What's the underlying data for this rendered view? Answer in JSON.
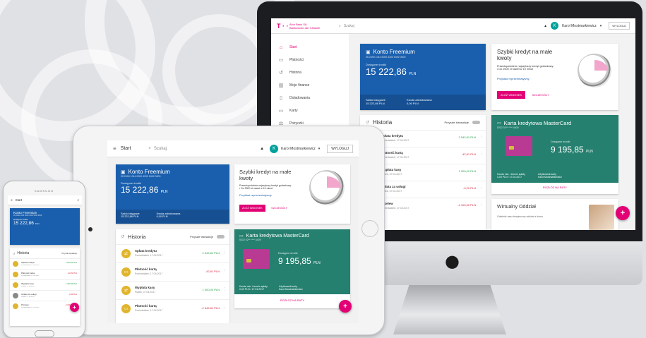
{
  "brand": {
    "logo": "T · ·",
    "name_line1": "Alior Bank SA",
    "name_line2": "Bankowość dla T-Mobile"
  },
  "search": {
    "placeholder": "Szukaj",
    "icon": "search-icon"
  },
  "user": {
    "initial": "K",
    "name": "Karol Mostmarkiewicz",
    "name_ipad": "Karol Mostmarkiewicz"
  },
  "logout_label": "WYLOGUJ",
  "page_title": "Start",
  "sidebar": {
    "items": [
      {
        "label": "Start",
        "icon": "home-icon",
        "glyph": "⌂"
      },
      {
        "label": "Płatności",
        "icon": "transfer-icon",
        "glyph": "▭"
      },
      {
        "label": "Historia",
        "icon": "history-icon",
        "glyph": "↺"
      },
      {
        "label": "Moje finanse",
        "icon": "chart-icon",
        "glyph": "▥"
      },
      {
        "label": "Doładowania",
        "icon": "phone-icon",
        "glyph": "▯"
      },
      {
        "label": "Karty",
        "icon": "card-icon",
        "glyph": "▭"
      },
      {
        "label": "Pożyczki",
        "icon": "loan-icon",
        "glyph": "⚖"
      }
    ]
  },
  "account": {
    "title": "Konto Freemium",
    "number": "05 2490 1044 0000 4200 5492 0000",
    "available_label": "Dostępne środki",
    "balance": "15 222,86",
    "currency": "PLN",
    "book_balance_label": "Saldo księgowe",
    "book_balance": "15 222,86 PLN",
    "blocked_label": "Kwota zablokowana",
    "blocked": "0,00 PLN"
  },
  "loan_promo": {
    "title": "Szybki kredyt na małe kwoty",
    "desc": "Prawdopodobnie najszybszy kredyt gotówkowy:",
    "bullet": "Do 2500 zł nawet w 10 minut",
    "link": "Przykład reprezentatywny",
    "apply_button": "ZŁÓŻ WNIOSEK",
    "details_button": "SZCZEGÓŁY"
  },
  "history": {
    "title": "Historia",
    "future_label": "Przyszłe transakcje",
    "rows": [
      {
        "name": "Spłata kredytu",
        "date": "Poniedziałek, 17.04.2017",
        "amount": "2 542,81 PLN",
        "type": "pos",
        "glyph": "⇄"
      },
      {
        "name": "Płatność kartą",
        "date": "Poniedziałek, 17.04.2017",
        "amount": "-42,81 PLN",
        "type": "neg",
        "glyph": "▭"
      },
      {
        "name": "Wypłata kasy",
        "date": "Piątek, 07.04.2017",
        "amount": "1 000,00 PLN",
        "type": "pos",
        "glyph": "⇄"
      },
      {
        "name": "Płatność kartą",
        "date": "Poniedziałek, 17.04.2017",
        "amount": "-2 542,81 PLN",
        "type": "neg",
        "glyph": "▭"
      }
    ]
  },
  "history_imac": {
    "rows": [
      {
        "name": "Spłata kredytu",
        "date": "Poniedziałek, 17.04.2017",
        "amount": "2 542,81 PLN",
        "type": "pos"
      },
      {
        "name": "Płatność kartą",
        "date": "Poniedziałek, 17.04.2017",
        "amount": "-42,81 PLN",
        "type": "neg"
      },
      {
        "name": "Wypłata kasy",
        "date": "Piątek, 07.04.2017",
        "amount": "1 000,00 PLN",
        "type": "pos"
      },
      {
        "name": "Opłata za usługi",
        "date": "Piątek, 07.04.2017",
        "amount": "-0,20 PLN",
        "type": "neg"
      },
      {
        "name": "Przelew",
        "date": "Poniedziałek, 27.03.2017",
        "amount": "-4 100,00 PLN",
        "type": "neg"
      }
    ]
  },
  "credit_card": {
    "title": "Karta kredytowa MasterCard",
    "number": "5232 02** **** 4409",
    "available_label": "Dostępne środki",
    "balance": "9 195,85",
    "currency": "PLN",
    "min_pay_label": "Kwota min. i termin spłaty",
    "min_pay": "0,00 PLN / 17.04.2017",
    "holder_label": "Użytkownik karty",
    "holder": "Karol Mostmarkiewicz",
    "installments_link": "ROZŁÓŻ NA RATY"
  },
  "branch": {
    "title": "Wirtualny Oddział",
    "desc": "Odwiedź nasz bezpieczny oddział z domu"
  },
  "phone": {
    "brand": "SAMSUNG",
    "history_title": "Historia",
    "future_label": "Przyszłe transakcje"
  },
  "fab_label": "+",
  "colors": {
    "magenta": "#e20074",
    "blue": "#1a5fad",
    "green": "#25806f"
  }
}
